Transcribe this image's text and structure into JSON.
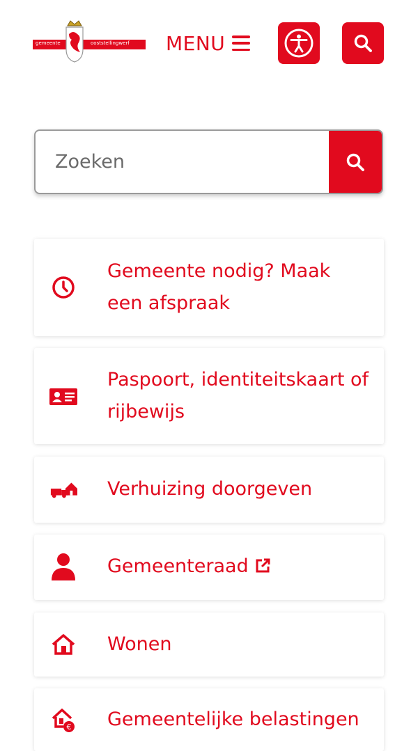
{
  "header": {
    "logo_text_left": "gemeente",
    "logo_text_right": "ooststellingwerf",
    "menu_label": "MENU"
  },
  "search": {
    "placeholder": "Zoeken"
  },
  "tiles": [
    {
      "label": "Gemeente nodig? Maak een afspraak",
      "icon": "clock-icon"
    },
    {
      "label": "Paspoort, identiteitskaart of rijbewijs",
      "icon": "id-card-icon"
    },
    {
      "label": "Verhuizing doorgeven",
      "icon": "moving-truck-icon"
    },
    {
      "label": "Gemeenteraad",
      "icon": "person-icon"
    },
    {
      "label": "Wonen",
      "icon": "house-icon"
    },
    {
      "label": "Gemeentelijke belastingen",
      "icon": "house-euro-icon"
    }
  ],
  "colors": {
    "accent": "#e10a1e",
    "background": "#ffffff"
  }
}
